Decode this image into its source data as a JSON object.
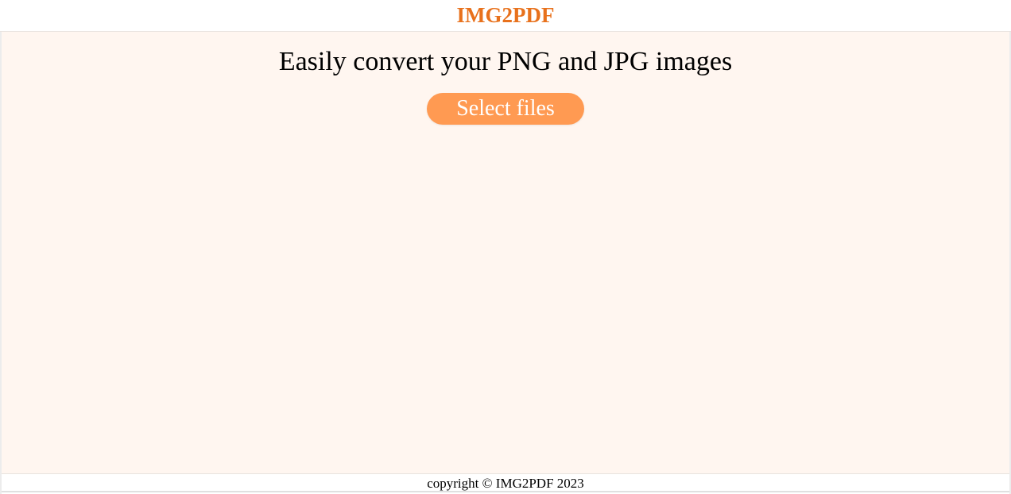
{
  "header": {
    "brand": "IMG2PDF"
  },
  "main": {
    "headline": "Easily convert your PNG and JPG images",
    "select_button_label": "Select files"
  },
  "footer": {
    "copyright": "copyright © IMG2PDF 2023"
  },
  "colors": {
    "brand": "#e8711c",
    "button": "#ff9a52",
    "page_background": "#fff6f0"
  }
}
